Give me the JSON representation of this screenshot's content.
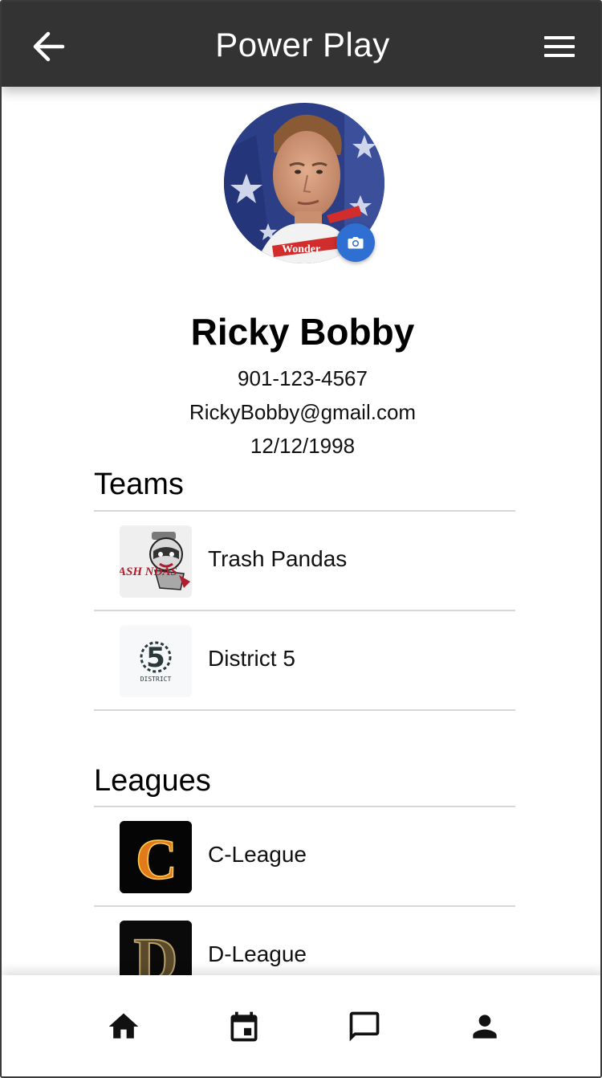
{
  "app": {
    "title": "Power Play"
  },
  "profile": {
    "name": "Ricky Bobby",
    "phone": "901-123-4567",
    "email": "RickyBobby@gmail.com",
    "birthdate": "12/12/1998"
  },
  "teams": {
    "heading": "Teams",
    "items": [
      {
        "label": "Trash Pandas",
        "logo_text": "ASH NDAS"
      },
      {
        "label": "District 5",
        "logo_text": "5",
        "logo_subtext": "DISTRICT"
      }
    ]
  },
  "leagues": {
    "heading": "Leagues",
    "items": [
      {
        "label": "C-League",
        "logo_text": "C"
      },
      {
        "label": "D-League",
        "logo_text": "D"
      }
    ]
  },
  "icons": {
    "back": "arrow-left-icon",
    "menu": "hamburger-menu-icon",
    "camera": "camera-icon",
    "home": "home-icon",
    "calendar": "calendar-icon",
    "chat": "chat-icon",
    "profile": "person-icon"
  },
  "colors": {
    "appbar": "#333333",
    "camera_button": "#2f6fd1",
    "divider": "#d6d6d6"
  }
}
